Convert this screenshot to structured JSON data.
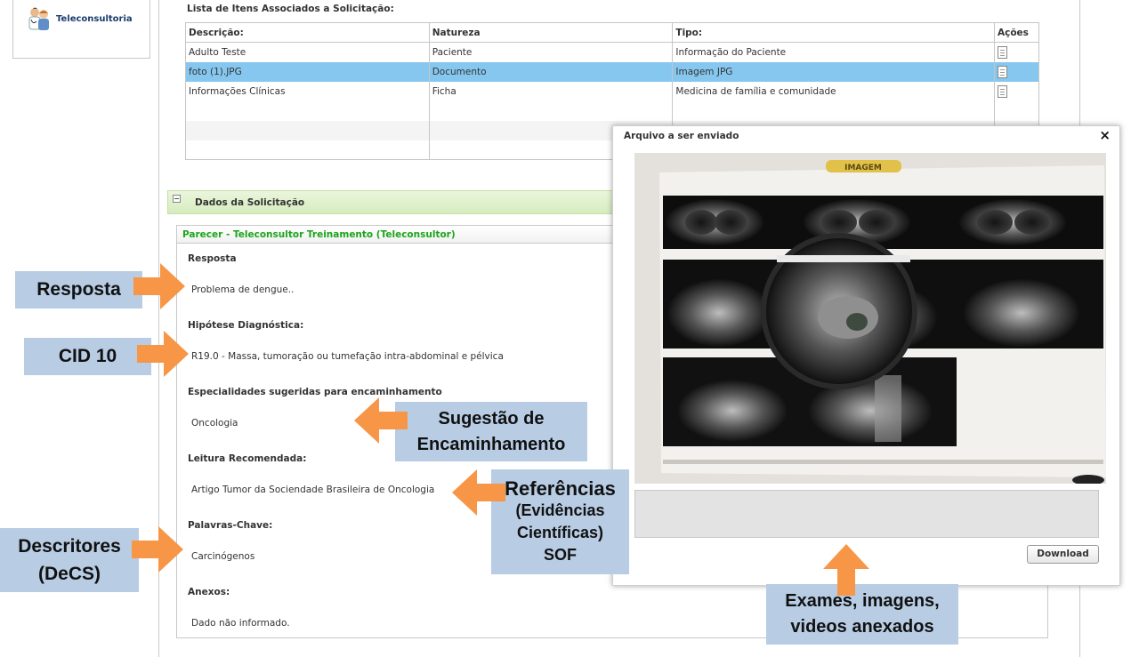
{
  "sidebar": {
    "item_label": "Teleconsultoria"
  },
  "items_list": {
    "title": "Lista de Itens Associados a Solicitação:",
    "headers": {
      "descricao": "Descrição:",
      "natureza": "Natureza",
      "tipo": "Tipo:",
      "acoes": "Ações"
    },
    "rows": [
      {
        "descricao": "Adulto Teste",
        "natureza": "Paciente",
        "tipo": "Informação do Paciente"
      },
      {
        "descricao": "foto (1).JPG",
        "natureza": "Documento",
        "tipo": "Imagem JPG"
      },
      {
        "descricao": "Informações Clínicas",
        "natureza": "Ficha",
        "tipo": "Medicina de família e comunidade"
      }
    ]
  },
  "section": {
    "title": "Dados da Solicitação"
  },
  "parecer": {
    "header": "Parecer - Teleconsultor Treinamento (Teleconsultor)",
    "resposta_label": "Resposta",
    "resposta_value": "Problema de dengue..",
    "hipotese_label": "Hipótese Diagnóstica:",
    "hipotese_value": "R19.0 - Massa, tumoração ou tumefação intra-abdominal e pélvica",
    "especialidades_label": "Especialidades sugeridas para encaminhamento",
    "especialidades_value": "Oncologia",
    "leitura_label": "Leitura Recomendada:",
    "leitura_value": "Artigo Tumor da Sociendade Brasileira de Oncologia",
    "palavras_label": "Palavras-Chave:",
    "palavras_value": "Carcinógenos",
    "anexos_label": "Anexos:",
    "anexos_value": "Dado não informado."
  },
  "modal": {
    "title": "Arquivo a ser enviado",
    "close": "×",
    "download_label": "Download",
    "image_banner": "IMAGEM"
  },
  "callouts": {
    "resposta": "Resposta",
    "cid": "CID 10",
    "sugestao_1": "Sugestão de",
    "sugestao_2": "Encaminhamento",
    "referencias_1": "Referências",
    "referencias_2": "(Evidências",
    "referencias_3": "Científicas)",
    "referencias_4": "SOF",
    "descritores_1": "Descritores",
    "descritores_2": "(DeCS)",
    "exames_1": "Exames, imagens,",
    "exames_2": "videos anexados"
  },
  "colors": {
    "accent_green": "#1ba51b",
    "selected_row": "#86c7ef",
    "callout_bg": "#b8cce4",
    "arrow_orange": "#f79646"
  }
}
